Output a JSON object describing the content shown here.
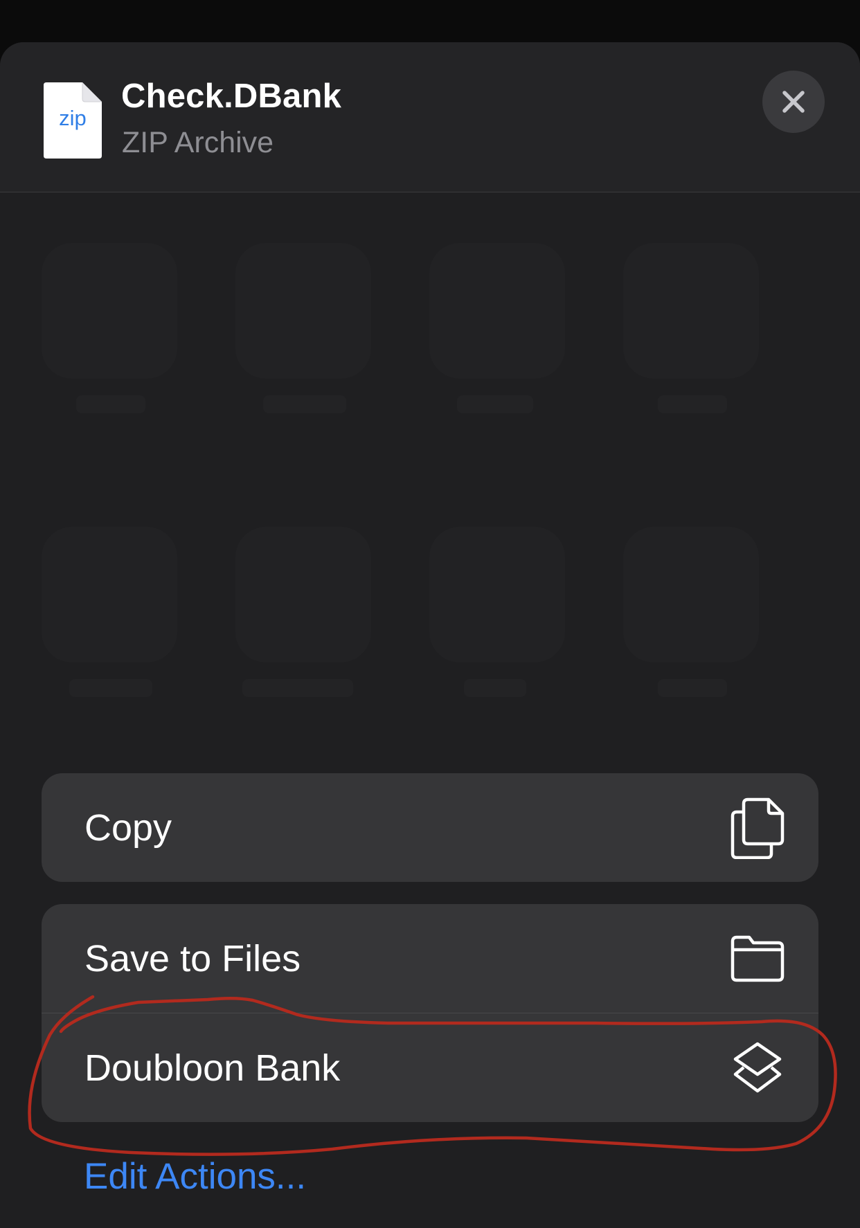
{
  "header": {
    "file_icon_label": "zip",
    "title": "Check.DBank",
    "subtitle": "ZIP Archive"
  },
  "actions": {
    "group1": [
      {
        "label": "Copy",
        "icon": "copy-icon"
      }
    ],
    "group2": [
      {
        "label": "Save to Files",
        "icon": "folder-icon"
      },
      {
        "label": "Doubloon Bank",
        "icon": "shortcuts-icon"
      }
    ]
  },
  "footer": {
    "edit_actions_label": "Edit Actions..."
  },
  "colors": {
    "sheet_background": "#1f1f21",
    "row_background": "#363638",
    "link": "#3d87f5",
    "annotation": "#b22a1e"
  }
}
